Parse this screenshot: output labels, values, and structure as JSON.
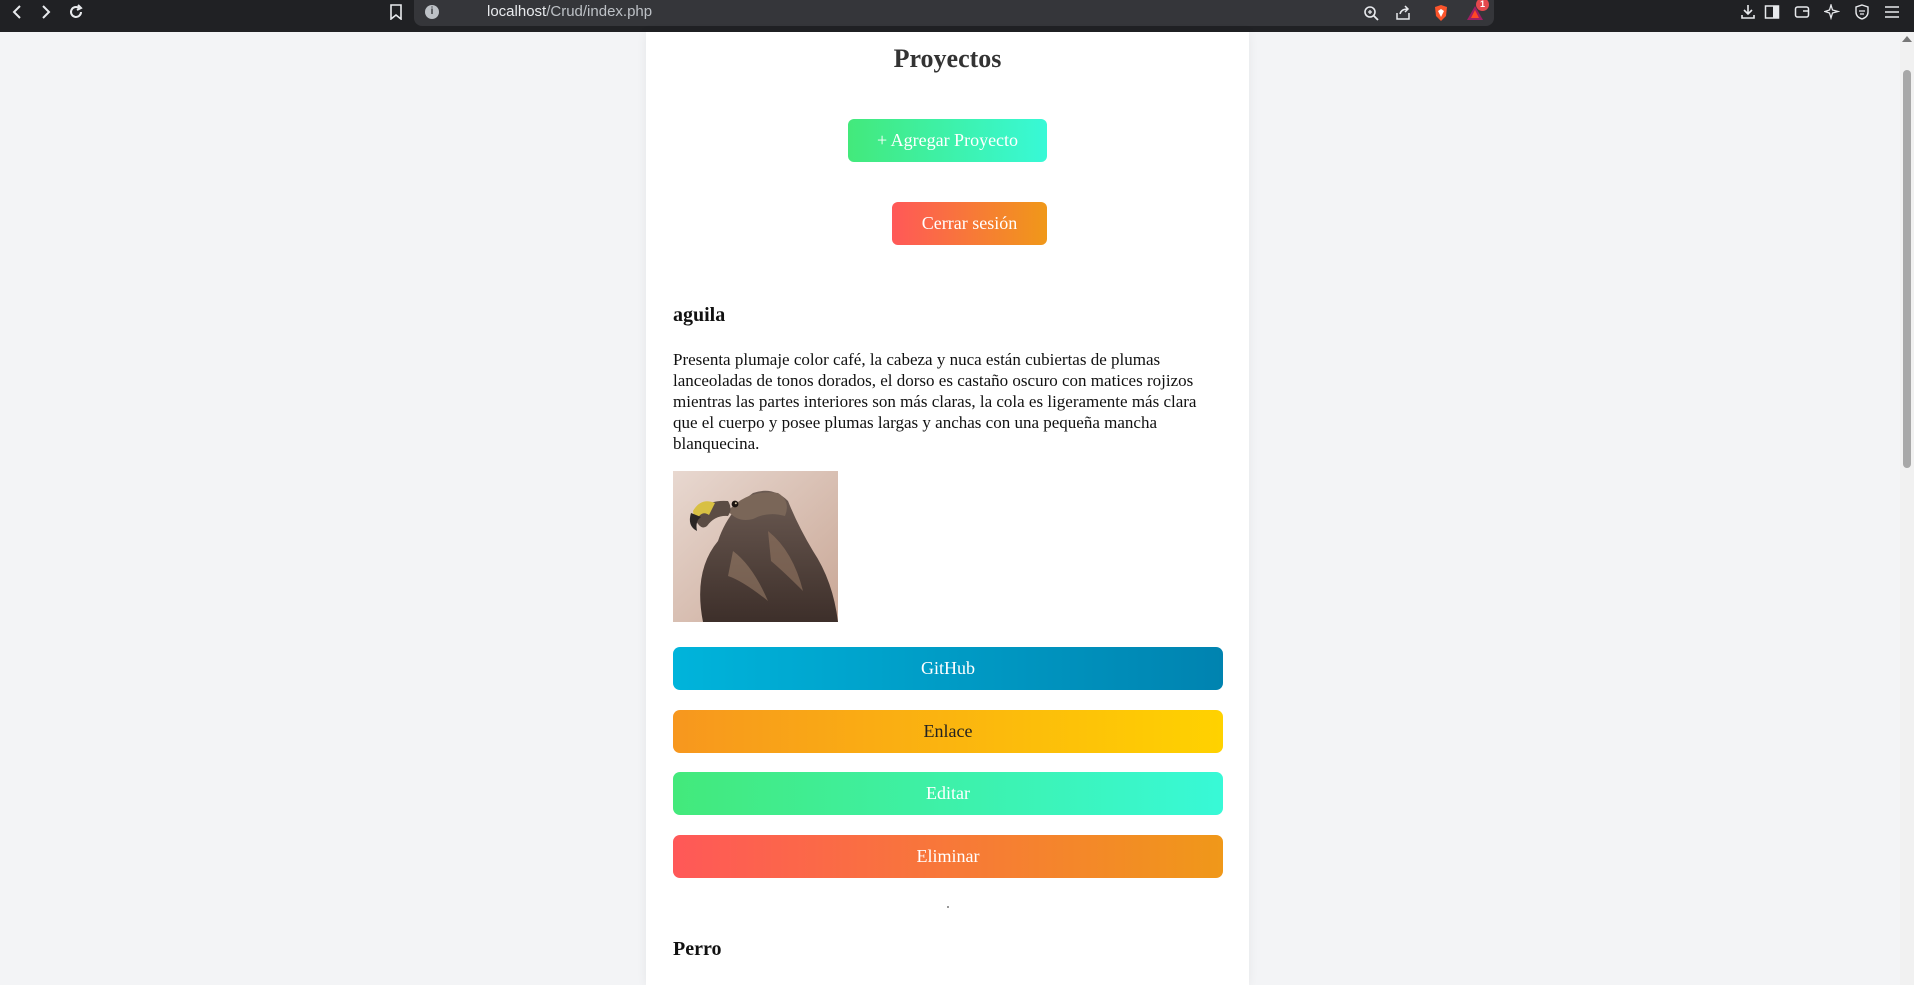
{
  "browser": {
    "url_host": "localhost",
    "url_path": "/Crud/index.php",
    "info_glyph": "i",
    "notification_count": "1",
    "icons": [
      "back-arrow-icon",
      "forward-arrow-icon",
      "reload-icon",
      "bookmark-icon",
      "site-info-icon",
      "zoom-icon",
      "share-icon",
      "brave-shield-icon",
      "brave-rewards-icon",
      "download-icon",
      "sidebar-icon",
      "wallet-icon",
      "leo-ai-icon",
      "vpn-icon",
      "menu-icon"
    ]
  },
  "page": {
    "title": "Proyectos",
    "add_button": "+ Agregar Proyecto",
    "logout_button": "Cerrar sesión"
  },
  "projects": [
    {
      "name": "aguila",
      "description": "Presenta plumaje color café, la cabeza y nuca están cubiertas de plumas lanceoladas de tonos dorados, el dorso es castaño oscuro con matices rojizos mientras las partes interiores son más claras, la cola es ligeramente más clara que el cuerpo y posee plumas largas y anchas con una pequeña mancha blanquecina.",
      "image": "eagle-photo",
      "github_button": "GitHub",
      "link_button": "Enlace",
      "edit_button": "Editar",
      "delete_button": "Eliminar"
    },
    {
      "name": "Perro"
    }
  ],
  "colors": {
    "add_gradient": [
      "#43e97b",
      "#38f9d7"
    ],
    "logout_gradient": [
      "#ff5858",
      "#f09819"
    ],
    "github_gradient": [
      "#00b4db",
      "#0083b0"
    ],
    "link_gradient": [
      "#f7971e",
      "#ffd200"
    ]
  }
}
